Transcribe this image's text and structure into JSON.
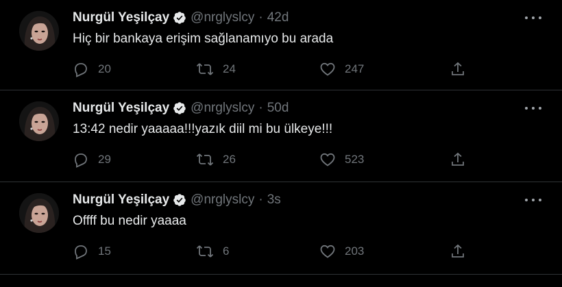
{
  "colors": {
    "background": "#000000",
    "text_primary": "#e7e9ea",
    "text_secondary": "#71767b",
    "divider": "#2f3336",
    "verified_badge": "#e7e9ea"
  },
  "icons": {
    "reply": "reply-icon",
    "retweet": "retweet-icon",
    "like": "heart-icon",
    "share": "share-icon",
    "more": "more-icon",
    "verified": "verified-badge-icon"
  },
  "tweets": [
    {
      "author_name": "Nurgül Yeşilçay",
      "handle": "@nrglyslcy",
      "separator": "·",
      "time": "42d",
      "text": "Hiç bir bankaya erişim sağlanamıyo bu arada",
      "replies": "20",
      "retweets": "24",
      "likes": "247"
    },
    {
      "author_name": "Nurgül Yeşilçay",
      "handle": "@nrglyslcy",
      "separator": "·",
      "time": "50d",
      "text": "13:42 nedir yaaaaa!!!yazık diil mi bu ülkeye!!!",
      "replies": "29",
      "retweets": "26",
      "likes": "523"
    },
    {
      "author_name": "Nurgül Yeşilçay",
      "handle": "@nrglyslcy",
      "separator": "·",
      "time": "3s",
      "text": "Offff bu nedir yaaaa",
      "replies": "15",
      "retweets": "6",
      "likes": "203"
    }
  ]
}
